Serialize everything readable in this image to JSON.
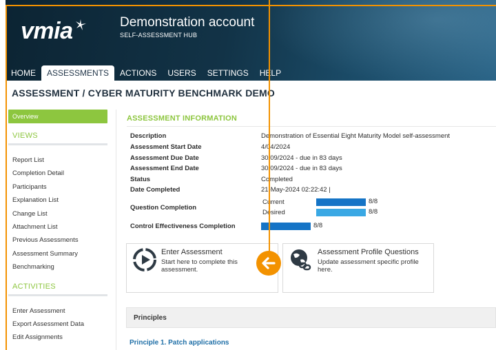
{
  "header": {
    "logo_text": "vmia",
    "account_title": "Demonstration account",
    "account_subtitle": "SELF-ASSESSMENT HUB"
  },
  "nav": {
    "items": [
      "HOME",
      "ASSESSMENTS",
      "ACTIONS",
      "USERS",
      "SETTINGS",
      "HELP"
    ],
    "active": "ASSESSMENTS"
  },
  "page_title": "ASSESSMENT / CYBER MATURITY BENCHMARK DEMO",
  "sidebar": {
    "overview": "Overview",
    "views_heading": "VIEWS",
    "views": [
      "Report List",
      "Completion Detail",
      "Participants",
      "Explanation List",
      "Change List",
      "Attachment List",
      "Previous Assessments",
      "Assessment Summary",
      "Benchmarking"
    ],
    "activities_heading": "ACTIVITIES",
    "activities": [
      "Enter Assessment",
      "Export Assessment Data",
      "Edit Assignments"
    ]
  },
  "info": {
    "heading": "ASSESSMENT INFORMATION",
    "description_label": "Description",
    "description": "Demonstration of Essential Eight Maturity Model self-assessment",
    "start_label": "Assessment Start Date",
    "start": "4/04/2024",
    "due_label": "Assessment Due Date",
    "due": "30/09/2024 - due in 83 days",
    "end_label": "Assessment End Date",
    "end": "30/09/2024 - due in 83 days",
    "status_label": "Status",
    "status": "Completed",
    "completed_label": "Date Completed",
    "completed": "21-May-2024 02:22:42 |",
    "question_label": "Question Completion",
    "current_label": "Current",
    "current_count": "8/8",
    "current_fraction": 1.0,
    "desired_label": "Desired",
    "desired_count": "8/8",
    "desired_fraction": 1.0,
    "control_label": "Control Effectiveness Completion",
    "control_count": "8/8",
    "control_fraction": 1.0
  },
  "cards": {
    "enter_title": "Enter Assessment",
    "enter_desc": "Start here to complete this assessment.",
    "profile_title": "Assessment Profile Questions",
    "profile_desc": "Update assessment specific profile here."
  },
  "principles": {
    "label": "Principles",
    "first": "Principle 1. Patch applications"
  },
  "colors": {
    "accent_green": "#8dc63f",
    "bar_blue_dark": "#1574c6",
    "bar_blue_light": "#3aa8e4",
    "annotation_orange": "#f39200"
  }
}
